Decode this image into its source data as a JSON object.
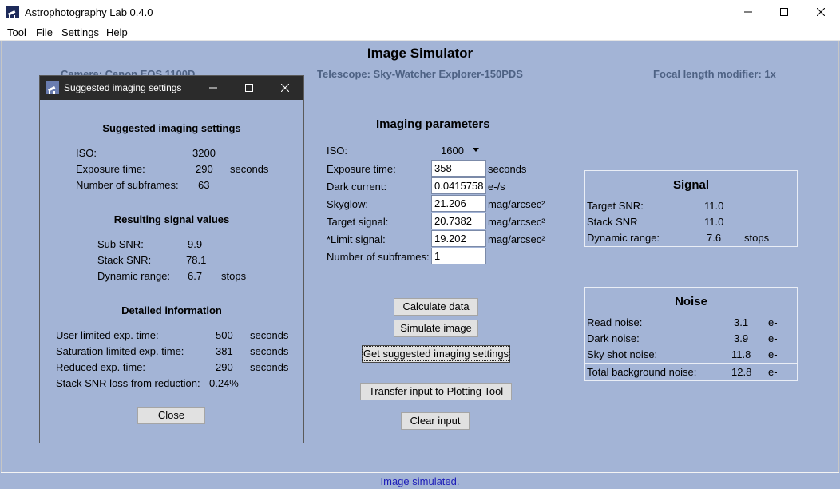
{
  "window": {
    "title": "Astrophotography Lab 0.4.0"
  },
  "menu": [
    "Tool",
    "File",
    "Settings",
    "Help"
  ],
  "page": {
    "title": "Image Simulator",
    "camera": "Camera: Canon EOS 1100D",
    "telescope": "Telescope: Sky-Watcher Explorer-150PDS",
    "focal_modifier": "Focal length modifier: 1x"
  },
  "params": {
    "heading": "Imaging parameters",
    "iso_label": "ISO:",
    "iso_value": "1600",
    "exposure_label": "Exposure time:",
    "exposure_value": "358",
    "exposure_unit": "seconds",
    "dark_label": "Dark current:",
    "dark_value": "0.0415758",
    "dark_unit": "e-/s",
    "skyglow_label": "Skyglow:",
    "skyglow_value": "21.206",
    "skyglow_unit": "mag/arcsec²",
    "target_label": "Target signal:",
    "target_value": "20.7382",
    "target_unit": "mag/arcsec²",
    "limit_label": "*Limit signal:",
    "limit_value": "19.202",
    "limit_unit": "mag/arcsec²",
    "subframes_label": "Number of subframes:",
    "subframes_value": "1"
  },
  "buttons": {
    "calculate": "Calculate data",
    "simulate": "Simulate image",
    "suggested": "Get suggested imaging settings",
    "transfer": "Transfer input to Plotting Tool",
    "clear": "Clear input"
  },
  "signal": {
    "heading": "Signal",
    "target_snr_label": "Target SNR:",
    "target_snr": "11.0",
    "stack_snr_label": "Stack SNR",
    "stack_snr": "11.0",
    "dr_label": "Dynamic range:",
    "dr": "7.6",
    "dr_unit": "stops"
  },
  "noise": {
    "heading": "Noise",
    "read_label": "Read noise:",
    "read": "3.1",
    "dark_label": "Dark noise:",
    "dark": "3.9",
    "sky_label": "Sky shot noise:",
    "sky": "11.8",
    "total_label": "Total background noise:",
    "total": "12.8",
    "unit": "e-"
  },
  "status": "Image simulated.",
  "popup": {
    "title": "Suggested imaging settings",
    "heading": "Suggested imaging settings",
    "iso_label": "ISO:",
    "iso": "3200",
    "exp_label": "Exposure time:",
    "exp": "290",
    "exp_unit": "seconds",
    "subs_label": "Number of subframes:",
    "subs": "63",
    "result_heading": "Resulting signal values",
    "sub_snr_label": "Sub SNR:",
    "sub_snr": "9.9",
    "stack_snr_label": "Stack SNR:",
    "stack_snr": "78.1",
    "dr_label": "Dynamic range:",
    "dr": "6.7",
    "dr_unit": "stops",
    "detail_heading": "Detailed information",
    "user_label": "User limited exp. time:",
    "user": "500",
    "sat_label": "Saturation limited exp. time:",
    "sat": "381",
    "reduced_label": "Reduced exp. time:",
    "reduced": "290",
    "seconds": "seconds",
    "loss_label": "Stack SNR loss from reduction:",
    "loss": "0.24%",
    "close": "Close"
  },
  "icons": {
    "app": "app-icon",
    "minimize": "minimize-icon",
    "maximize": "maximize-icon",
    "close": "close-icon",
    "dropdown": "chevron-down-icon"
  }
}
